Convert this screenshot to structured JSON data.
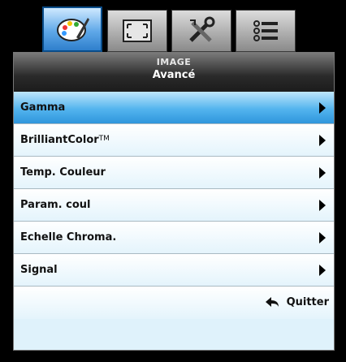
{
  "tabs": [
    {
      "name": "picture-icon",
      "active": true
    },
    {
      "name": "display-icon",
      "active": false
    },
    {
      "name": "setup-icon",
      "active": false
    },
    {
      "name": "options-icon",
      "active": false
    }
  ],
  "header": {
    "category": "IMAGE",
    "title": "Avancé"
  },
  "menu": {
    "items": [
      {
        "label": "Gamma",
        "selected": true
      },
      {
        "label": "BrilliantColor",
        "sup": "TM"
      },
      {
        "label": "Temp. Couleur"
      },
      {
        "label": "Param. coul"
      },
      {
        "label": "Echelle Chroma."
      },
      {
        "label": "Signal"
      }
    ]
  },
  "footer": {
    "quit_label": "Quitter",
    "quit_icon": "return-arrow-icon"
  }
}
